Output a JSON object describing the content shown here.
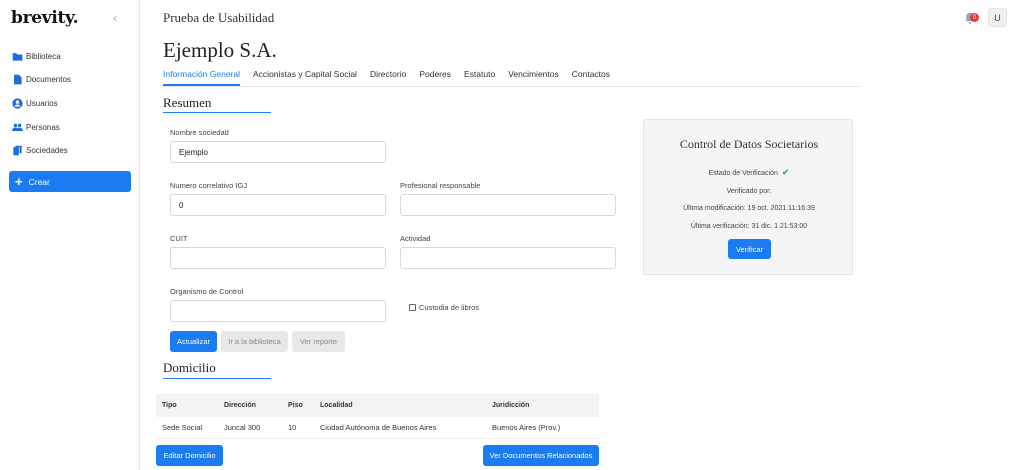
{
  "sidebar": {
    "logo": "brevity.",
    "collapse_glyph": "‹",
    "items": [
      {
        "label": "Biblioteca",
        "icon": "folder-icon"
      },
      {
        "label": "Documentos",
        "icon": "document-icon"
      },
      {
        "label": "Usuarios",
        "icon": "user-icon"
      },
      {
        "label": "Personas",
        "icon": "people-icon"
      },
      {
        "label": "Sociedades",
        "icon": "copy-icon"
      }
    ],
    "create_label": "Crear"
  },
  "header": {
    "app_title": "Prueba de Usabilidad",
    "notification_count": "0",
    "avatar_initial": "U"
  },
  "page": {
    "company_name": "Ejemplo S.A.",
    "tabs": [
      {
        "label": "Información General",
        "active": true
      },
      {
        "label": "Accionistas y Capital Social",
        "active": false
      },
      {
        "label": "Directorio",
        "active": false
      },
      {
        "label": "Poderes",
        "active": false
      },
      {
        "label": "Estatuto",
        "active": false
      },
      {
        "label": "Vencimientos",
        "active": false
      },
      {
        "label": "Contactos",
        "active": false
      }
    ]
  },
  "resumen": {
    "title": "Resumen",
    "fields": {
      "nombre_label": "Nombre sociedad",
      "nombre_value": "Ejemplo",
      "numero_label": "Numero correlativo IGJ",
      "numero_value": "0",
      "profesional_label": "Profesional responsable",
      "profesional_value": "",
      "cuit_label": "CUIT",
      "cuit_value": "",
      "actividad_label": "Actividad",
      "actividad_value": "",
      "organismo_label": "Organismo de Control",
      "organismo_value": ""
    },
    "custodia_label": "Custodia de libros",
    "custodia_checked": false,
    "buttons": {
      "actualizar": "Actualizar",
      "biblioteca": "Ir a la biblioteca",
      "reporte": "Ver reporte"
    }
  },
  "control": {
    "title": "Control de Datos Societarios",
    "estado": "Estado de Verificación",
    "verificado_por": "Verificado por:",
    "ultima_modificacion": "Última modificación: 19 oct. 2021 11:16:39",
    "ultima_verificacion": "Última verificación: 31 dic. 1 21:53:00",
    "verificar": "Verificar"
  },
  "domicilio": {
    "title": "Domicilio",
    "columns": [
      "Tipo",
      "Dirección",
      "Piso",
      "Localidad",
      "Juridicción"
    ],
    "rows": [
      [
        "Sede Social",
        "Juncal 300",
        "10",
        "Ciudad Autónoma de Buenos Aires",
        "Buenos Aires (Prov.)"
      ]
    ],
    "edit_button": "Editar Domicilio",
    "docs_button": "Ver Documentos Relacionados"
  },
  "colors": {
    "accent": "#1a7cf0",
    "badge": "#e53935",
    "check": "#2a9d3c"
  }
}
